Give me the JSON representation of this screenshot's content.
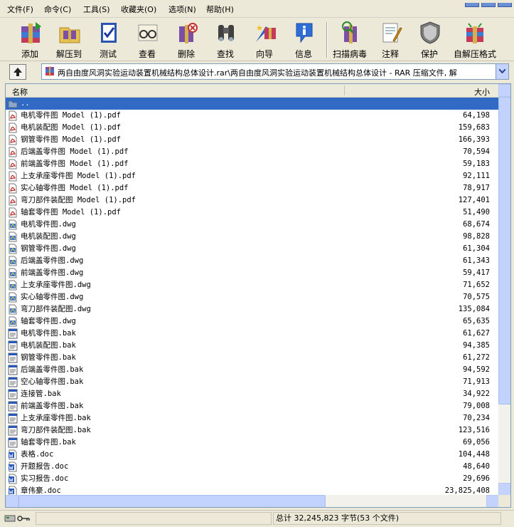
{
  "menu": [
    "文件(F)",
    "命令(C)",
    "工具(S)",
    "收藏夹(O)",
    "选项(N)",
    "帮助(H)"
  ],
  "toolbar": [
    {
      "label": "添加",
      "icon": "add-archive-icon"
    },
    {
      "label": "解压到",
      "icon": "extract-to-icon"
    },
    {
      "label": "测试",
      "icon": "test-archive-icon"
    },
    {
      "label": "查看",
      "icon": "view-glasses-icon"
    },
    {
      "label": "删除",
      "icon": "delete-icon"
    },
    {
      "label": "查找",
      "icon": "find-binoculars-icon"
    },
    {
      "label": "向导",
      "icon": "wizard-icon"
    },
    {
      "label": "信息",
      "icon": "info-icon"
    },
    {
      "label": "扫描病毒",
      "icon": "scan-virus-icon"
    },
    {
      "label": "注释",
      "icon": "comment-icon"
    },
    {
      "label": "保护",
      "icon": "protect-shield-icon"
    },
    {
      "label": "自解压格式",
      "icon": "sfx-icon"
    }
  ],
  "address": {
    "path": "两自由度风洞实验运动装置机械结构总体设计.rar\\两自由度风洞实验运动装置机械结构总体设计 - RAR 压缩文件, 解"
  },
  "columns": {
    "name": "名称",
    "size": "大小"
  },
  "files": [
    {
      "name": "..",
      "size": "",
      "type": "folder"
    },
    {
      "name": "电机零件图 Model (1).pdf",
      "size": "64,198",
      "type": "pdf"
    },
    {
      "name": "电机装配图 Model (1).pdf",
      "size": "159,683",
      "type": "pdf"
    },
    {
      "name": "钢管零件图 Model (1).pdf",
      "size": "166,393",
      "type": "pdf"
    },
    {
      "name": "后端盖零件图 Model (1).pdf",
      "size": "70,594",
      "type": "pdf"
    },
    {
      "name": "前端盖零件图 Model (1).pdf",
      "size": "59,183",
      "type": "pdf"
    },
    {
      "name": "上支承座零件图 Model (1).pdf",
      "size": "92,111",
      "type": "pdf"
    },
    {
      "name": "实心轴零件图 Model (1).pdf",
      "size": "78,917",
      "type": "pdf"
    },
    {
      "name": "弯刀部件装配图 Model (1).pdf",
      "size": "127,401",
      "type": "pdf"
    },
    {
      "name": "轴套零件图 Model (1).pdf",
      "size": "51,490",
      "type": "pdf"
    },
    {
      "name": "电机零件图.dwg",
      "size": "68,674",
      "type": "dwg"
    },
    {
      "name": "电机装配图.dwg",
      "size": "98,828",
      "type": "dwg"
    },
    {
      "name": "钢管零件图.dwg",
      "size": "61,304",
      "type": "dwg"
    },
    {
      "name": "后端盖零件图.dwg",
      "size": "61,343",
      "type": "dwg"
    },
    {
      "name": "前端盖零件图.dwg",
      "size": "59,417",
      "type": "dwg"
    },
    {
      "name": "上支承座零件图.dwg",
      "size": "71,652",
      "type": "dwg"
    },
    {
      "name": "实心轴零件图.dwg",
      "size": "70,575",
      "type": "dwg"
    },
    {
      "name": "弯刀部件装配图.dwg",
      "size": "135,084",
      "type": "dwg"
    },
    {
      "name": "轴套零件图.dwg",
      "size": "65,635",
      "type": "dwg"
    },
    {
      "name": "电机零件图.bak",
      "size": "61,627",
      "type": "bak"
    },
    {
      "name": "电机装配图.bak",
      "size": "94,385",
      "type": "bak"
    },
    {
      "name": "钢管零件图.bak",
      "size": "61,272",
      "type": "bak"
    },
    {
      "name": "后端盖零件图.bak",
      "size": "94,592",
      "type": "bak"
    },
    {
      "name": "空心轴零件图.bak",
      "size": "71,913",
      "type": "bak"
    },
    {
      "name": "连接管.bak",
      "size": "34,922",
      "type": "bak"
    },
    {
      "name": "前端盖零件图.bak",
      "size": "79,008",
      "type": "bak"
    },
    {
      "name": "上支承座零件图.bak",
      "size": "70,234",
      "type": "bak"
    },
    {
      "name": "弯刀部件装配图.bak",
      "size": "123,516",
      "type": "bak"
    },
    {
      "name": "轴套零件图.bak",
      "size": "69,056",
      "type": "bak"
    },
    {
      "name": "表格.doc",
      "size": "104,448",
      "type": "doc"
    },
    {
      "name": "开题报告.doc",
      "size": "48,640",
      "type": "doc"
    },
    {
      "name": "实习报告.doc",
      "size": "29,696",
      "type": "doc"
    },
    {
      "name": "章伟豪.doc",
      "size": "23,825,408",
      "type": "doc"
    }
  ],
  "status": {
    "total": "总计 32,245,823 字节(53 个文件)"
  },
  "colors": {
    "selection": "#316ac5",
    "background": "#ece9d8"
  }
}
